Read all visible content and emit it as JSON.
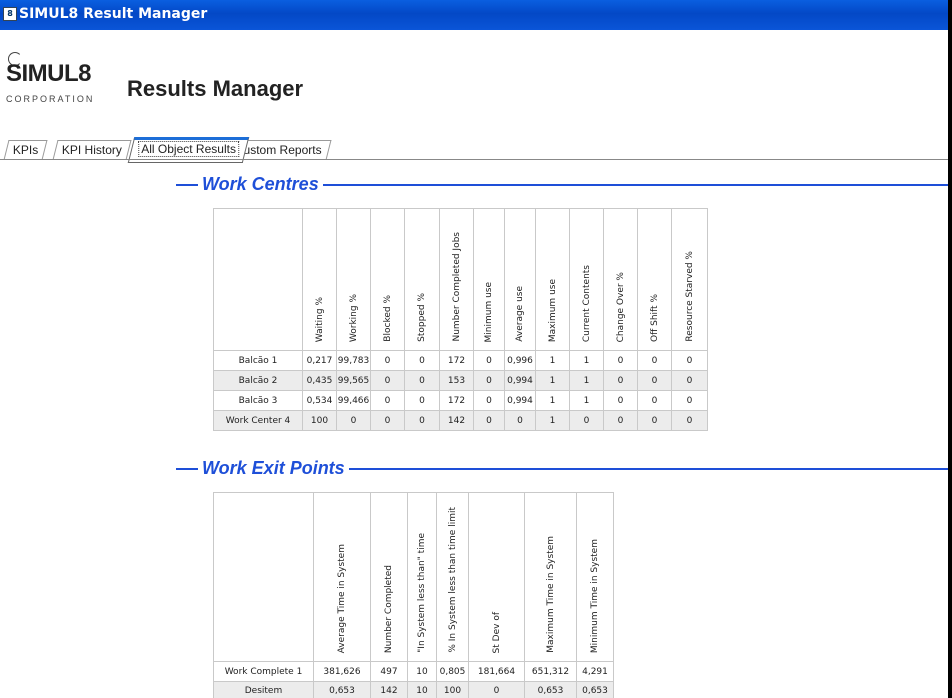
{
  "window": {
    "title": "SIMUL8 Result Manager"
  },
  "header": {
    "logo_text": "SIMUL8",
    "logo_sub": "CORPORATION",
    "title": "Results Manager"
  },
  "tabs": [
    {
      "label": "KPIs",
      "active": false
    },
    {
      "label": "KPI History",
      "active": false
    },
    {
      "label": "All Object Results",
      "active": true
    },
    {
      "label": "Custom Reports",
      "active": false
    }
  ],
  "work_centres": {
    "heading": "Work Centres",
    "columns": [
      "Waiting %",
      "Working %",
      "Blocked %",
      "Stopped %",
      "Number Completed Jobs",
      "Minimum use",
      "Average use",
      "Maximum use",
      "Current Contents",
      "Change Over %",
      "Off Shift %",
      "Resource Starved %"
    ],
    "rows": [
      {
        "name": "Balcão 1",
        "values": [
          "0,217",
          "99,783",
          "0",
          "0",
          "172",
          "0",
          "0,996",
          "1",
          "1",
          "0",
          "0",
          "0"
        ]
      },
      {
        "name": "Balcão 2",
        "values": [
          "0,435",
          "99,565",
          "0",
          "0",
          "153",
          "0",
          "0,994",
          "1",
          "1",
          "0",
          "0",
          "0"
        ]
      },
      {
        "name": "Balcão 3",
        "values": [
          "0,534",
          "99,466",
          "0",
          "0",
          "172",
          "0",
          "0,994",
          "1",
          "1",
          "0",
          "0",
          "0"
        ]
      },
      {
        "name": "Work Center 4",
        "values": [
          "100",
          "0",
          "0",
          "0",
          "142",
          "0",
          "0",
          "1",
          "0",
          "0",
          "0",
          "0"
        ]
      }
    ]
  },
  "work_exit_points": {
    "heading": "Work Exit Points",
    "columns": [
      "Average Time in System",
      "Number Completed",
      "\"In System less than\" time",
      "% In System less than time limit",
      "St Dev of",
      "Maximum Time in System",
      "Minimum Time in System"
    ],
    "rows": [
      {
        "name": "Work Complete 1",
        "values": [
          "381,626",
          "497",
          "10",
          "0,805",
          "181,664",
          "651,312",
          "4,291"
        ]
      },
      {
        "name": "Desitem",
        "values": [
          "0,653",
          "142",
          "10",
          "100",
          "0",
          "0,653",
          "0,653"
        ]
      }
    ]
  },
  "colors": {
    "accent": "#1e4fd8",
    "titlebar": "#0348c6",
    "row_alt": "#ececec"
  }
}
